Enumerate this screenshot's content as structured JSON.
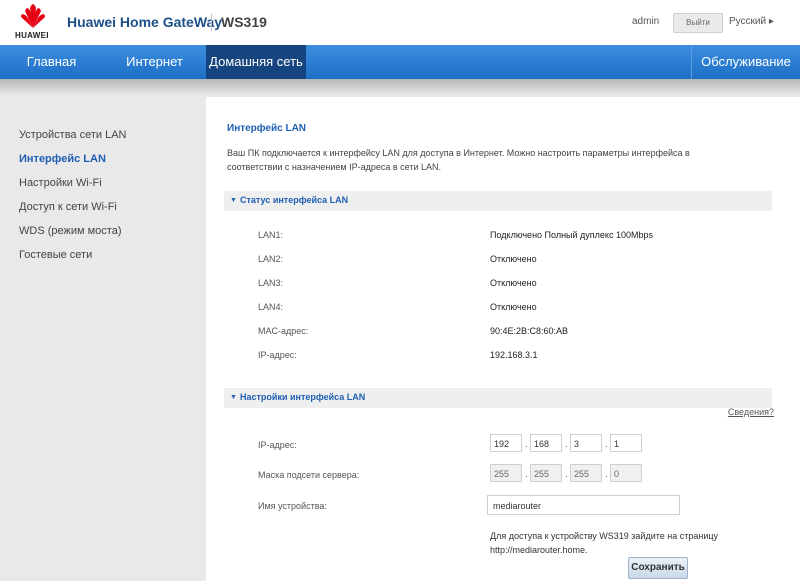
{
  "header": {
    "brand": "HUAWEI",
    "product": "Huawei Home GateWay",
    "model": "WS319",
    "user": "admin",
    "logout_label": "Выйти",
    "language": "Русский ▸"
  },
  "nav": {
    "home": "Главная",
    "internet": "Интернет",
    "home_network": "Домашняя сеть",
    "maintenance": "Обслуживание",
    "active": "Домашняя сеть"
  },
  "sidebar": {
    "items": [
      {
        "label": "Устройства сети LAN"
      },
      {
        "label": "Интерфейс LAN"
      },
      {
        "label": "Настройки Wi-Fi"
      },
      {
        "label": "Доступ к сети Wi-Fi"
      },
      {
        "label": "WDS (режим моста)"
      },
      {
        "label": "Гостевые сети"
      }
    ],
    "active_index": 1
  },
  "content": {
    "title": "Интерфейс LAN",
    "description": "Ваш ПК подключается к интерфейсу LAN для доступа в Интернет. Можно настроить параметры интерфейса в соответствии с назначением IP-адреса в сети LAN.",
    "status_section": {
      "title": "Статус интерфейса LAN",
      "rows": [
        {
          "label": "LAN1:",
          "value": "Подключено Полный дуплекс 100Mbps"
        },
        {
          "label": "LAN2:",
          "value": "Отключено"
        },
        {
          "label": "LAN3:",
          "value": "Отключено"
        },
        {
          "label": "LAN4:",
          "value": "Отключено"
        },
        {
          "label": "MAC-адрес:",
          "value": "90:4E:2B:C8:60:AB"
        },
        {
          "label": "IP-адрес:",
          "value": "192.168.3.1"
        }
      ]
    },
    "settings_section": {
      "title": "Настройки интерфейса LAN",
      "help_link": "Сведения?",
      "ip_label": "IP-адрес:",
      "ip_octets": [
        "192",
        "168",
        "3",
        "1"
      ],
      "mask_label": "Маска подсети сервера:",
      "mask_octets": [
        "255",
        "255",
        "255",
        "0"
      ],
      "device_name_label": "Имя устройства:",
      "device_name_value": "mediarouter",
      "hint": "Для доступа к устройству WS319 зайдите на страницу http://mediarouter.home.",
      "save_label": "Сохранить"
    }
  },
  "colors": {
    "nav_bg": "#2a7fd4",
    "nav_active": "#16447f",
    "accent_text": "#1e5fb3",
    "logo_red": "#e60012"
  }
}
